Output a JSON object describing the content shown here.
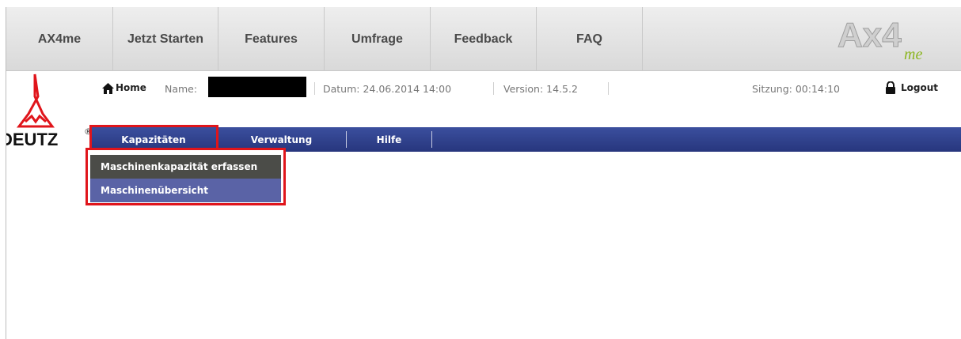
{
  "top_nav": {
    "items": [
      {
        "label": "AX4me"
      },
      {
        "label": "Jetzt Starten"
      },
      {
        "label": "Features"
      },
      {
        "label": "Umfrage"
      },
      {
        "label": "Feedback"
      },
      {
        "label": "FAQ"
      }
    ],
    "logo": {
      "text_main": "Ax4",
      "text_sub": "me"
    }
  },
  "header": {
    "home_label": "Home",
    "name_label": "Name:",
    "datum": "Datum: 24.06.2014 14:00",
    "version": "Version: 14.5.2",
    "sitzung": "Sitzung: 00:14:10",
    "logout_label": "Logout"
  },
  "brand": {
    "logo_text": "DEUTZ",
    "registered_mark": "®"
  },
  "menu": {
    "items": [
      {
        "label": "Kapazitäten"
      },
      {
        "label": "Verwaltung"
      },
      {
        "label": "Hilfe"
      }
    ],
    "dropdown": [
      {
        "label": "Maschinenkapazität erfassen"
      },
      {
        "label": "Maschinenübersicht"
      }
    ]
  },
  "colors": {
    "menu_bar": "#2f3f8c",
    "highlight_border": "#e0151b",
    "dropdown_item_dark": "#4b4c48",
    "dropdown_item_hover": "#5a63a6",
    "deutz_red": "#e0151b",
    "ax_logo_green": "#8bb51f"
  },
  "icons": {
    "home": "home-icon",
    "lock": "lock-icon"
  }
}
